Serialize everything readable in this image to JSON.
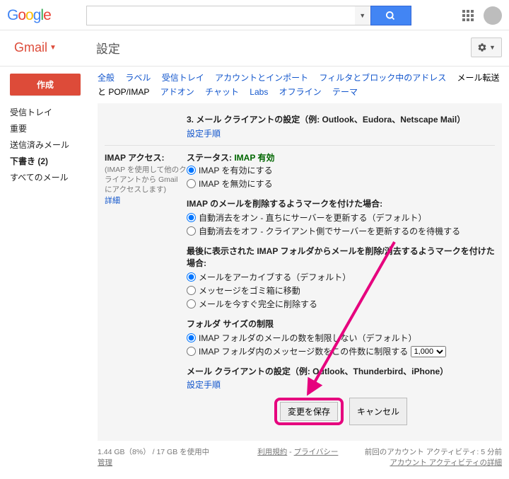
{
  "logo": {
    "g1": "G",
    "o1": "o",
    "o2": "o",
    "g2": "g",
    "l": "l",
    "e": "e"
  },
  "header": {
    "search_placeholder": ""
  },
  "subheader": {
    "gmail": "Gmail",
    "title": "設定"
  },
  "sidebar": {
    "compose": "作成",
    "items": [
      "受信トレイ",
      "重要",
      "送信済みメール",
      "下書き (2)",
      "すべてのメール"
    ]
  },
  "tabs": [
    "全般",
    "ラベル",
    "受信トレイ",
    "アカウントとインポート",
    "フィルタとブロック中のアドレス",
    "メール転送と POP/IMAP",
    "アドオン",
    "チャット",
    "Labs",
    "オフライン",
    "テーマ"
  ],
  "active_tab": "メール転送と POP/IMAP",
  "section3": {
    "title": "3. メール クライアントの設定（例: Outlook、Eudora、Netscape Mail）",
    "link": "設定手順"
  },
  "imap": {
    "left_title": "IMAP アクセス:",
    "left_desc": "(IMAP を使用して他のクライアントから Gmail にアクセスします)",
    "detail_link": "詳細",
    "status_label": "ステータス:",
    "status_value": "IMAP 有効",
    "enable": "IMAP を有効にする",
    "disable": "IMAP を無効にする",
    "delete_head": "IMAP のメールを削除するようマークを付けた場合:",
    "delete_opt1": "自動消去をオン - 直ちにサーバーを更新する（デフォルト）",
    "delete_opt2": "自動消去をオフ - クライアント側でサーバーを更新するのを待機する",
    "last_head": "最後に表示された IMAP フォルダからメールを削除/消去するようマークを付けた場合:",
    "last_opt1": "メールをアーカイブする（デフォルト）",
    "last_opt2": "メッセージをゴミ箱に移動",
    "last_opt3": "メールを今すぐ完全に削除する",
    "folder_head": "フォルダ サイズの制限",
    "folder_opt1": "IMAP フォルダのメールの数を制限しない（デフォルト）",
    "folder_opt2_a": "IMAP フォルダ内のメッセージ数をこの件数に制限する",
    "folder_select": "1,000",
    "client_head": "メール クライアントの設定（例: Outlook、Thunderbird、iPhone）",
    "client_link": "設定手順"
  },
  "buttons": {
    "save": "変更を保存",
    "cancel": "キャンセル"
  },
  "footer": {
    "storage": "1.44 GB（8%） / 17 GB を使用中",
    "manage": "管理",
    "terms": "利用規約",
    "privacy": "プライバシー",
    "sep": " - ",
    "activity1": "前回のアカウント アクティビティ: 5 分前",
    "activity2": "アカウント アクティビティの詳細"
  }
}
